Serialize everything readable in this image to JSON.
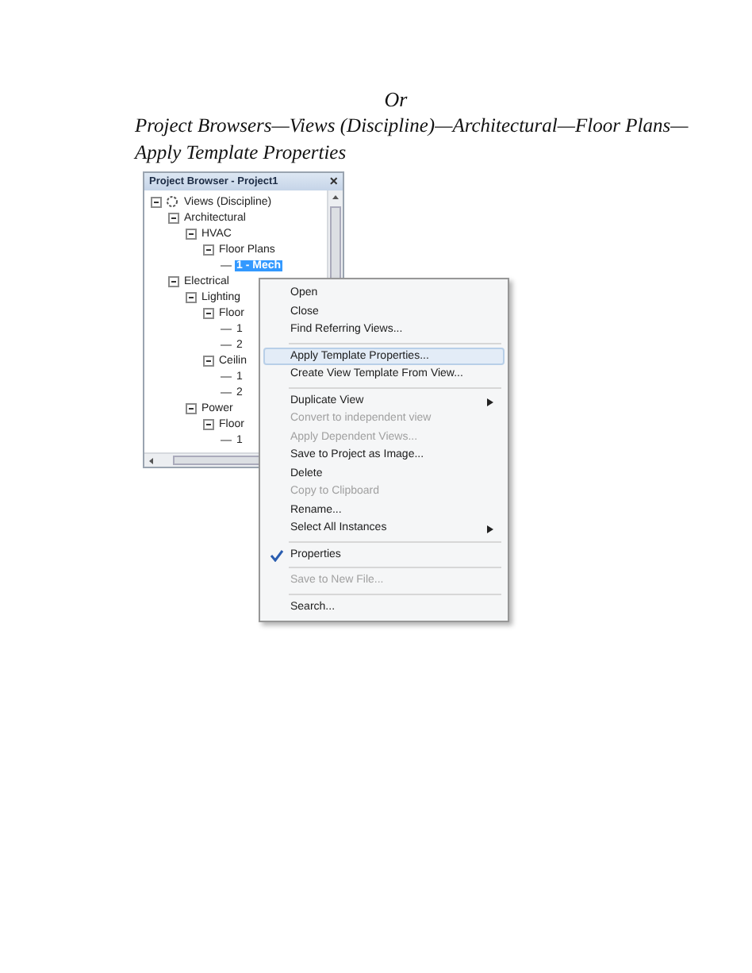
{
  "heading": {
    "or_line": "Or",
    "path_lines": [
      "Project Browsers—Views (Discipline)—Architectural—Floor Plans—",
      "Apply Template Properties"
    ]
  },
  "browser": {
    "title": "Project Browser - Project1",
    "close": "×",
    "tree": [
      {
        "label": "Views (Discipline)",
        "expanded": true,
        "selected": false,
        "children": [
          {
            "label": "Architectural",
            "expanded": true,
            "selected": false,
            "children": [
              {
                "label": "HVAC",
                "expanded": true,
                "selected": false,
                "children": [
                  {
                    "label": "Floor Plans",
                    "expanded": true,
                    "selected": false,
                    "children": [
                      {
                        "label": "1 - Mech",
                        "selected": true
                      }
                    ]
                  }
                ]
              }
            ]
          },
          {
            "label": "Electrical",
            "expanded": true,
            "selected": false,
            "children": [
              {
                "label": "Lighting",
                "expanded": true,
                "selected": false,
                "children": [
                  {
                    "label": "Floor",
                    "expanded": true,
                    "selected": false,
                    "children": [
                      {
                        "label": "1",
                        "selected": false
                      },
                      {
                        "label": "2",
                        "selected": false
                      }
                    ]
                  },
                  {
                    "label": "Ceilin",
                    "expanded": true,
                    "selected": false,
                    "children": [
                      {
                        "label": "1",
                        "selected": false
                      },
                      {
                        "label": "2",
                        "selected": false
                      }
                    ]
                  }
                ]
              },
              {
                "label": "Power",
                "expanded": true,
                "selected": false,
                "children": [
                  {
                    "label": "Floor",
                    "expanded": true,
                    "selected": false,
                    "children": [
                      {
                        "label": "1",
                        "selected": false
                      }
                    ]
                  }
                ]
              }
            ]
          }
        ]
      }
    ]
  },
  "context_menu": [
    {
      "kind": "item",
      "label": "Open",
      "disabled": false,
      "selected": false,
      "checked": false,
      "submenu": false
    },
    {
      "kind": "item",
      "label": "Close",
      "disabled": false,
      "selected": false,
      "checked": false,
      "submenu": false
    },
    {
      "kind": "item",
      "label": "Find Referring Views...",
      "disabled": false,
      "selected": false,
      "checked": false,
      "submenu": false
    },
    {
      "kind": "separator"
    },
    {
      "kind": "item",
      "label": "Apply Template Properties...",
      "disabled": false,
      "selected": true,
      "checked": false,
      "submenu": false
    },
    {
      "kind": "item",
      "label": "Create View Template From View...",
      "disabled": false,
      "selected": false,
      "checked": false,
      "submenu": false
    },
    {
      "kind": "separator"
    },
    {
      "kind": "item",
      "label": "Duplicate View",
      "disabled": false,
      "selected": false,
      "checked": false,
      "submenu": true
    },
    {
      "kind": "item",
      "label": "Convert to independent view",
      "disabled": true,
      "selected": false,
      "checked": false,
      "submenu": false
    },
    {
      "kind": "item",
      "label": "Apply Dependent Views...",
      "disabled": true,
      "selected": false,
      "checked": false,
      "submenu": false
    },
    {
      "kind": "item",
      "label": "Save to Project as Image...",
      "disabled": false,
      "selected": false,
      "checked": false,
      "submenu": false
    },
    {
      "kind": "item",
      "label": "Delete",
      "disabled": false,
      "selected": false,
      "checked": false,
      "submenu": false
    },
    {
      "kind": "item",
      "label": "Copy to Clipboard",
      "disabled": true,
      "selected": false,
      "checked": false,
      "submenu": false
    },
    {
      "kind": "item",
      "label": "Rename...",
      "disabled": false,
      "selected": false,
      "checked": false,
      "submenu": false
    },
    {
      "kind": "item",
      "label": "Select All Instances",
      "disabled": false,
      "selected": false,
      "checked": false,
      "submenu": true
    },
    {
      "kind": "separator"
    },
    {
      "kind": "item",
      "label": "Properties",
      "disabled": false,
      "selected": false,
      "checked": true,
      "submenu": false
    },
    {
      "kind": "separator"
    },
    {
      "kind": "item",
      "label": "Save to New File...",
      "disabled": true,
      "selected": false,
      "checked": false,
      "submenu": false
    },
    {
      "kind": "separator"
    },
    {
      "kind": "item",
      "label": "Search...",
      "disabled": false,
      "selected": false,
      "checked": false,
      "submenu": false
    }
  ]
}
